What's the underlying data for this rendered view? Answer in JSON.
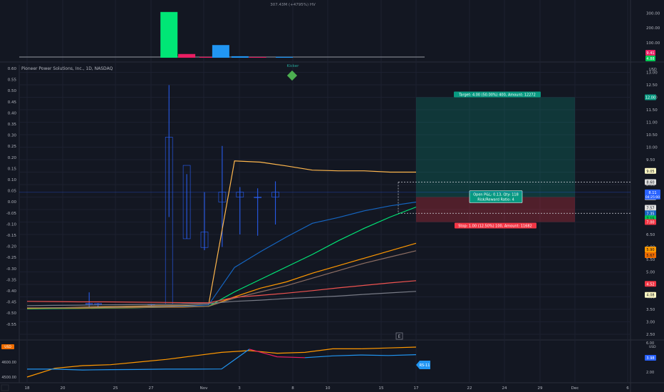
{
  "chart_data": {
    "type": "line",
    "title": "Pioneer Power Solutions, Inc., 1D, NASDAQ",
    "kicker_label": "Kicker",
    "volume_label": "307.43M (+4795%) HV",
    "x_ticks": [
      "18",
      "20",
      "25",
      "27",
      "Nov",
      "3",
      "8",
      "10",
      "15",
      "17",
      "22",
      "24",
      "29",
      "Dec",
      "6"
    ],
    "left_ticks": [
      "0.60",
      "0.55",
      "0.50",
      "0.45",
      "0.40",
      "0.35",
      "0.30",
      "0.25",
      "0.20",
      "0.15",
      "0.10",
      "0.05",
      "0.00",
      "-0.05",
      "-0.10",
      "-0.15",
      "-0.20",
      "-0.25",
      "-0.30",
      "-0.35",
      "-0.40",
      "-0.45",
      "-0.50",
      "-0.55"
    ],
    "right_ticks": [
      "13.00",
      "12.50",
      "12.00",
      "11.50",
      "11.00",
      "10.50",
      "10.00",
      "9.50",
      "9.00",
      "8.50",
      "8.00",
      "7.50",
      "7.00",
      "6.50",
      "6.00",
      "5.50",
      "5.00",
      "4.50",
      "4.00",
      "3.50",
      "3.00",
      "2.50"
    ],
    "volume_ticks": [
      "300.00",
      "200.00",
      "100.00"
    ],
    "lower_left_ticks": [
      "4600.00",
      "4500.00"
    ],
    "lower_right_ticks": [
      "6.00",
      "2.00"
    ],
    "currency": "USD",
    "ylim": [
      2.3,
      13.3
    ],
    "volume": {
      "bars": [
        {
          "x": 8,
          "value": 307,
          "color": "#00e676"
        },
        {
          "x": 9,
          "value": 25,
          "color": "#e91e63"
        },
        {
          "x": 10.2,
          "value": 6,
          "color": "#e91e63"
        },
        {
          "x": 11,
          "value": 85,
          "color": "#2196f3"
        },
        {
          "x": 12,
          "value": 10,
          "color": "#2196f3"
        },
        {
          "x": 13,
          "value": 5,
          "color": "#e91e63"
        },
        {
          "x": 14.5,
          "value": 6,
          "color": "#2196f3"
        }
      ],
      "max": 330
    },
    "candles": [
      {
        "x": 3.5,
        "o": 3.73,
        "h": 4.18,
        "l": 3.6,
        "c": 3.73
      },
      {
        "x": 4.0,
        "o": 3.73,
        "h": 3.75,
        "l": 3.58,
        "c": 3.7
      },
      {
        "x": 7.0,
        "o": 3.7,
        "h": 3.72,
        "l": 3.65,
        "c": 3.7
      },
      {
        "x": 8.0,
        "o": 3.7,
        "h": 12.49,
        "l": 7.2,
        "c": 10.4
      },
      {
        "x": 9.0,
        "o": 9.27,
        "h": 8.92,
        "l": 6.33,
        "c": 6.33
      },
      {
        "x": 10.0,
        "o": 6.6,
        "h": 8.2,
        "l": 5.87,
        "c": 5.98
      },
      {
        "x": 11.0,
        "o": 7.8,
        "h": 10.05,
        "l": 6.0,
        "c": 8.2
      },
      {
        "x": 12.0,
        "o": 8.2,
        "h": 8.4,
        "l": 6.5,
        "c": 8.0
      },
      {
        "x": 13.0,
        "o": 8.0,
        "h": 8.35,
        "l": 6.45,
        "c": 8.0
      },
      {
        "x": 14.0,
        "o": 8.0,
        "h": 8.63,
        "l": 6.9,
        "c": 8.2
      }
    ],
    "series": [
      {
        "color": "#ffb74d",
        "points": [
          [
            0,
            3.55
          ],
          [
            1,
            3.56
          ],
          [
            2,
            3.58
          ],
          [
            3,
            3.6
          ],
          [
            4,
            3.62
          ],
          [
            5,
            3.64
          ],
          [
            6,
            3.65
          ],
          [
            7,
            3.68
          ],
          [
            8,
            9.45
          ],
          [
            9,
            9.4
          ],
          [
            10,
            9.25
          ],
          [
            11,
            9.08
          ],
          [
            12,
            9.05
          ],
          [
            13,
            9.05
          ],
          [
            14,
            9.0
          ],
          [
            15,
            9.0
          ]
        ]
      },
      {
        "color": "#1565c0",
        "points": [
          [
            0,
            3.55
          ],
          [
            1,
            3.56
          ],
          [
            2,
            3.56
          ],
          [
            3,
            3.57
          ],
          [
            4,
            3.58
          ],
          [
            5,
            3.6
          ],
          [
            6,
            3.62
          ],
          [
            7,
            3.68
          ],
          [
            8,
            5.18
          ],
          [
            9,
            5.81
          ],
          [
            10,
            6.4
          ],
          [
            11,
            6.95
          ],
          [
            12,
            7.18
          ],
          [
            13,
            7.45
          ],
          [
            14,
            7.65
          ],
          [
            15,
            7.8
          ]
        ]
      },
      {
        "color": "#00e676",
        "points": [
          [
            0,
            3.52
          ],
          [
            1,
            3.53
          ],
          [
            2,
            3.54
          ],
          [
            3,
            3.55
          ],
          [
            4,
            3.56
          ],
          [
            5,
            3.58
          ],
          [
            6,
            3.6
          ],
          [
            7,
            3.62
          ],
          [
            8,
            4.2
          ],
          [
            9,
            4.7
          ],
          [
            10,
            5.2
          ],
          [
            11,
            5.7
          ],
          [
            12,
            6.25
          ],
          [
            13,
            6.75
          ],
          [
            14,
            7.2
          ],
          [
            15,
            7.6
          ]
        ]
      },
      {
        "color": "#ff9800",
        "points": [
          [
            0,
            3.54
          ],
          [
            1,
            3.55
          ],
          [
            2,
            3.55
          ],
          [
            3,
            3.56
          ],
          [
            4,
            3.57
          ],
          [
            5,
            3.58
          ],
          [
            6,
            3.59
          ],
          [
            7,
            3.62
          ],
          [
            8,
            4.0
          ],
          [
            9,
            4.35
          ],
          [
            10,
            4.6
          ],
          [
            11,
            4.95
          ],
          [
            12,
            5.25
          ],
          [
            13,
            5.55
          ],
          [
            14,
            5.85
          ],
          [
            15,
            6.15
          ]
        ]
      },
      {
        "color": "#8d6e63",
        "points": [
          [
            0,
            3.56
          ],
          [
            1,
            3.56
          ],
          [
            2,
            3.57
          ],
          [
            3,
            3.57
          ],
          [
            4,
            3.58
          ],
          [
            5,
            3.59
          ],
          [
            6,
            3.6
          ],
          [
            7,
            3.62
          ],
          [
            8,
            3.95
          ],
          [
            9,
            4.2
          ],
          [
            10,
            4.45
          ],
          [
            11,
            4.75
          ],
          [
            12,
            5.05
          ],
          [
            13,
            5.35
          ],
          [
            14,
            5.6
          ],
          [
            15,
            5.85
          ]
        ]
      },
      {
        "color": "#ef5350",
        "points": [
          [
            0,
            3.82
          ],
          [
            1,
            3.81
          ],
          [
            2,
            3.8
          ],
          [
            3,
            3.8
          ],
          [
            4,
            3.79
          ],
          [
            5,
            3.78
          ],
          [
            6,
            3.77
          ],
          [
            7,
            3.76
          ],
          [
            8,
            3.98
          ],
          [
            9,
            4.06
          ],
          [
            10,
            4.15
          ],
          [
            11,
            4.25
          ],
          [
            12,
            4.36
          ],
          [
            13,
            4.46
          ],
          [
            14,
            4.56
          ],
          [
            15,
            4.65
          ]
        ]
      },
      {
        "color": "#787b86",
        "points": [
          [
            0,
            3.65
          ],
          [
            1,
            3.66
          ],
          [
            2,
            3.67
          ],
          [
            3,
            3.68
          ],
          [
            4,
            3.69
          ],
          [
            5,
            3.7
          ],
          [
            6,
            3.71
          ],
          [
            7,
            3.73
          ],
          [
            8,
            3.82
          ],
          [
            9,
            3.87
          ],
          [
            10,
            3.93
          ],
          [
            11,
            3.98
          ],
          [
            12,
            4.03
          ],
          [
            13,
            4.1
          ],
          [
            14,
            4.16
          ],
          [
            15,
            4.22
          ]
        ]
      }
    ],
    "position": {
      "entry": 8.0,
      "target": 12.0,
      "stop": 7.0,
      "x_start": 15,
      "x_end": 20,
      "target_label": "Target: 4.00 (50.00%) 400, Amount: 12272",
      "center_label_1": "Open P&L: 0.13, Qty: 118",
      "center_label_2": "Risk/Reward Ratio: 4",
      "stop_label": "Stop: 1.00 (12.50%) 100, Amount: 11682"
    },
    "dashed_levels": [
      8.6,
      7.35
    ],
    "price_tags": [
      {
        "value": "12.00",
        "y": 12.0,
        "bg": "#089981",
        "fg": "#ffffff"
      },
      {
        "value": "9.05",
        "y": 9.05,
        "bg": "#fff9c4",
        "fg": "#131722"
      },
      {
        "value": "8.60",
        "y": 8.6,
        "bg": "#e0e0e0",
        "fg": "#131722"
      },
      {
        "value": "8.00",
        "y": 8.0,
        "bg": "#ffffff",
        "fg": "#131722"
      },
      {
        "value": "7.57",
        "y": 7.57,
        "bg": "#e0e0e0",
        "fg": "#131722"
      },
      {
        "value": "7.35",
        "y": 7.35,
        "bg": "#1565c0",
        "fg": "#ffffff"
      },
      {
        "value": "7.15",
        "y": 7.15,
        "bg": "#00c853",
        "fg": "#131722"
      },
      {
        "value": "7.00",
        "y": 7.0,
        "bg": "#f23645",
        "fg": "#ffffff"
      },
      {
        "value": "5.90",
        "y": 5.9,
        "bg": "#ff9800",
        "fg": "#131722"
      },
      {
        "value": "5.67",
        "y": 5.67,
        "bg": "#ef6c00",
        "fg": "#131722"
      },
      {
        "value": "4.52",
        "y": 4.52,
        "bg": "#f23645",
        "fg": "#ffffff"
      },
      {
        "value": "4.08",
        "y": 4.08,
        "bg": "#fff9c4",
        "fg": "#131722"
      }
    ],
    "current_price": {
      "value": "8.11",
      "time": "04:25:00",
      "y": 8.19
    },
    "volume_tags": [
      {
        "value": "9.41",
        "bg": "#e91e63"
      },
      {
        "value": "4.88",
        "bg": "#00c853"
      }
    ],
    "lower_pane": {
      "orange": [
        [
          0,
          4490
        ],
        [
          1,
          4540
        ],
        [
          2,
          4555
        ],
        [
          3,
          4560
        ],
        [
          4,
          4575
        ],
        [
          5,
          4590
        ],
        [
          6,
          4610
        ],
        [
          7,
          4630
        ],
        [
          8,
          4640
        ],
        [
          9,
          4625
        ],
        [
          10,
          4630
        ],
        [
          11,
          4650
        ],
        [
          12,
          4650
        ],
        [
          13,
          4655
        ],
        [
          14,
          4660
        ]
      ],
      "blue_pink": [
        [
          0,
          4535
        ],
        [
          1,
          4535
        ],
        [
          2,
          4530
        ],
        [
          3,
          4532
        ],
        [
          4,
          4533
        ],
        [
          5,
          4535
        ],
        [
          6,
          4535
        ],
        [
          7,
          4536
        ],
        [
          8,
          4648
        ],
        [
          9,
          4605
        ],
        [
          10,
          4600
        ],
        [
          11,
          4610
        ],
        [
          12,
          4615
        ],
        [
          13,
          4612
        ],
        [
          14,
          4617
        ]
      ],
      "tag_label": "RS-11",
      "right_tag": "3.98"
    }
  }
}
